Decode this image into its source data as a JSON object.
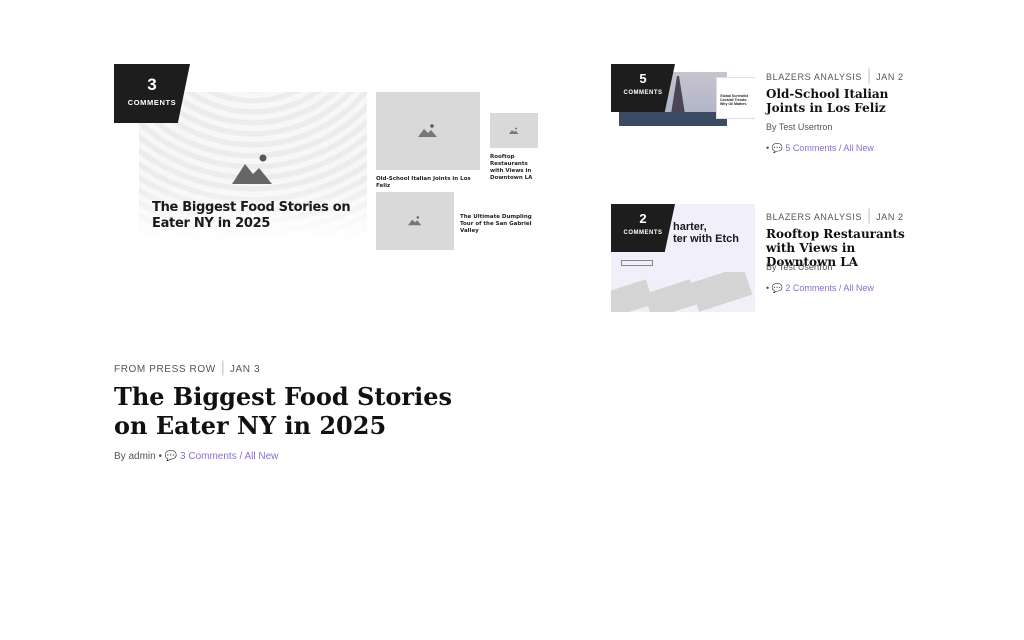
{
  "featured": {
    "comment_count": "3",
    "comment_label": "COMMENTS",
    "category": "FROM PRESS ROW",
    "date": "JAN 3",
    "title": "The Biggest Food Stories on Eater NY in 2025",
    "author_prefix": "By",
    "author": "admin",
    "separator": "•",
    "comments_link": "3 Comments / All New",
    "thumb": {
      "main_title": "The Biggest Food Stories on Eater NY in 2025",
      "cap_1": "Old-School Italian Joints in Los Feliz",
      "cap_2": "Rooftop Restaurants with Views in Downtown LA",
      "cap_3": "The Ultimate Dumpling Tour of the San Gabriel Valley"
    }
  },
  "side_posts": [
    {
      "comment_count": "5",
      "comment_label": "COMMENTS",
      "category": "BLAZERS ANALYSIS",
      "date": "JAN 2",
      "title": "Old-School Italian Joints in Los Feliz",
      "author_prefix": "By",
      "author": "Test Usertron",
      "separator": "•",
      "comments_link": "5 Comments / All New",
      "thumb_mini_text": "Global Surrealist Cocktail Trends: Why Oil Matters"
    },
    {
      "comment_count": "2",
      "comment_label": "COMMENTS",
      "category": "BLAZERS ANALYSIS",
      "date": "JAN 2",
      "title": "Rooftop Restaurants with Views in Downtown LA",
      "author_prefix": "By",
      "author": "Test Usertron",
      "separator": "•",
      "comments_link": "2 Comments / All New",
      "thumb_heading": "harter,\nter with Etch"
    }
  ],
  "colors": {
    "badge": "#1d1d1d",
    "link": "#8a6fc9",
    "placeholder": "#d9d9d9"
  }
}
